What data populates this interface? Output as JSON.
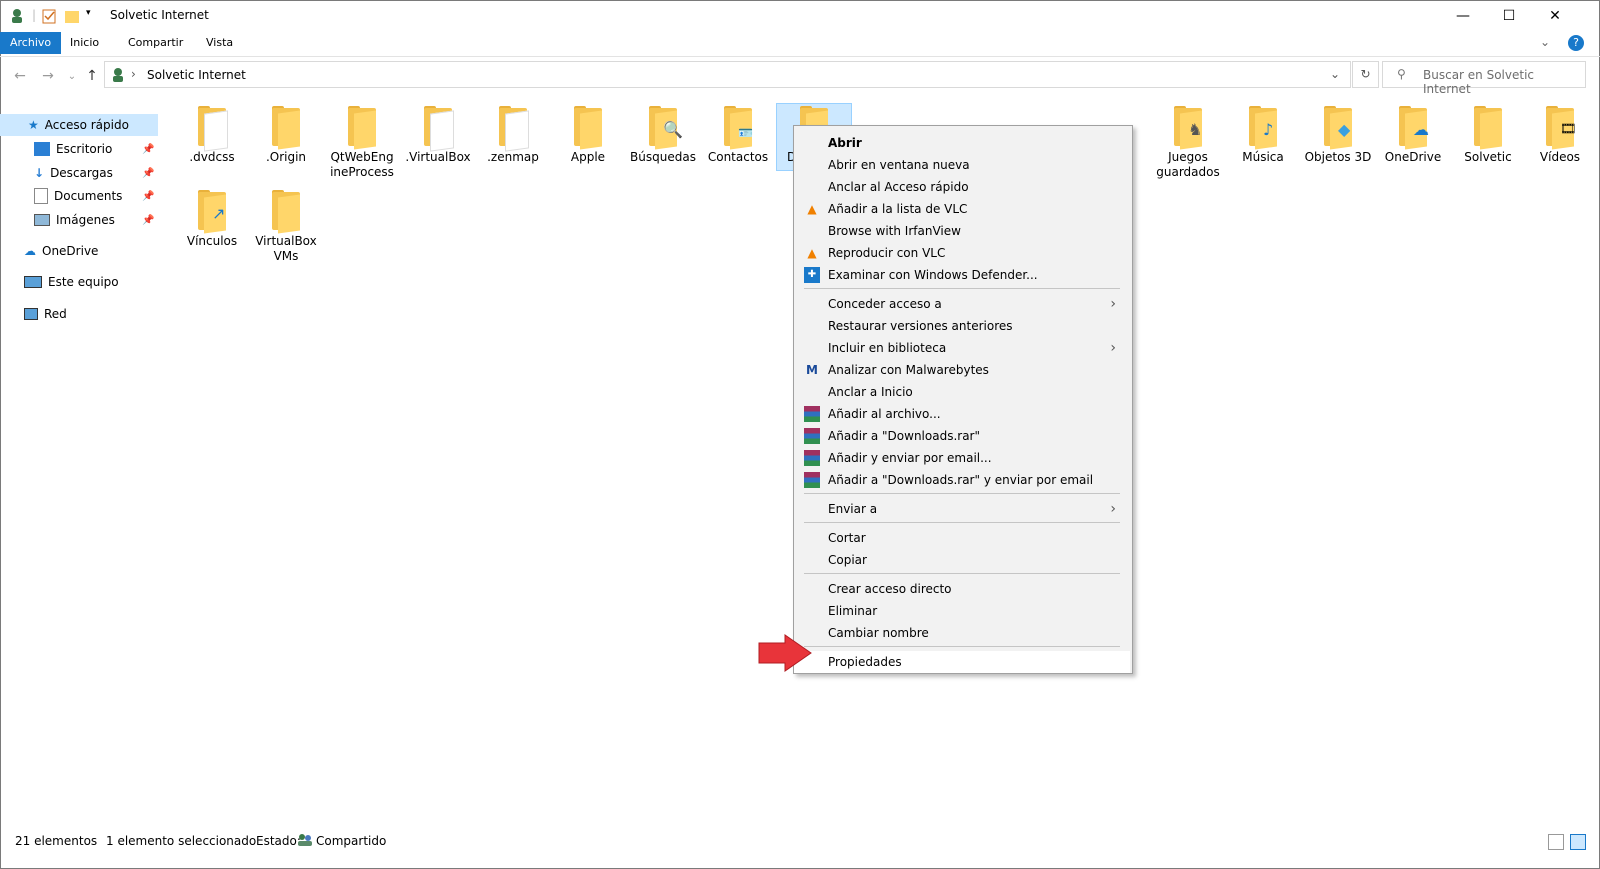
{
  "window": {
    "title": "Solvetic Internet"
  },
  "ribbon": {
    "tabs": [
      "Archivo",
      "Inicio",
      "Compartir",
      "Vista"
    ]
  },
  "address": {
    "path": "Solvetic Internet"
  },
  "search": {
    "placeholder": "Buscar en Solvetic Internet"
  },
  "nav": {
    "quick_access": "Acceso rápido",
    "items": [
      "Escritorio",
      "Descargas",
      "Documents",
      "Imágenes"
    ],
    "onedrive": "OneDrive",
    "this_pc": "Este equipo",
    "network": "Red"
  },
  "folders": {
    "row1": [
      ".dvdcss",
      ".Origin",
      "QtWebEng ineProcess",
      ".VirtualBox",
      ".zenmap",
      "Apple",
      "Búsquedas",
      "Contactos",
      "Desc",
      "Juegos guardados",
      "Música",
      "Objetos 3D",
      "OneDrive",
      "Solvetic",
      "Vídeos"
    ],
    "row2": [
      "Vínculos",
      "VirtualBox VMs"
    ]
  },
  "context_menu": {
    "items": [
      "Abrir",
      "Abrir en ventana nueva",
      "Anclar al Acceso rápido",
      "Añadir a la lista de VLC",
      "Browse with IrfanView",
      "Reproducir con VLC",
      "Examinar con Windows Defender...",
      "Conceder acceso a",
      "Restaurar versiones anteriores",
      "Incluir en biblioteca",
      "Analizar con Malwarebytes",
      "Anclar a Inicio",
      "Añadir al archivo...",
      "Añadir a \"Downloads.rar\"",
      "Añadir y enviar por email...",
      "Añadir a \"Downloads.rar\" y enviar por email",
      "Enviar a",
      "Cortar",
      "Copiar",
      "Crear acceso directo",
      "Eliminar",
      "Cambiar nombre",
      "Propiedades"
    ]
  },
  "status": {
    "count": "21 elementos",
    "selected": "1 elemento seleccionado",
    "state_label": "Estado:",
    "state_value": "Compartido"
  },
  "colors": {
    "accent": "#1979ca",
    "selection": "#cce8ff",
    "folder": "#f5c451",
    "arrow": "#e8343a"
  }
}
